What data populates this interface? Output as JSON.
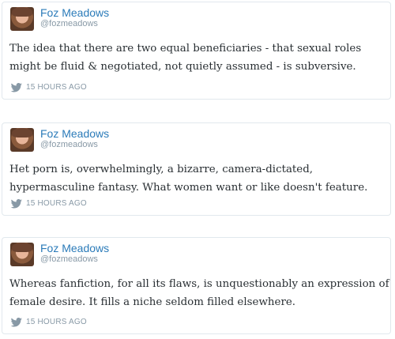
{
  "tweets": [
    {
      "author_name": "Foz Meadows",
      "author_handle": "@fozmeadows",
      "text": "The idea that there are two equal beneficiaries - that sexual roles might be fluid & negotiated, not quietly assumed - is subversive.",
      "timestamp": "15 HOURS AGO",
      "icon": "twitter-bird-icon"
    },
    {
      "author_name": "Foz Meadows",
      "author_handle": "@fozmeadows",
      "text": "Het porn is, overwhelmingly, a bizarre, camera-dictated, hypermasculine fantasy. What women want or like doesn't feature.",
      "timestamp": "15 HOURS AGO",
      "icon": "twitter-bird-icon"
    },
    {
      "author_name": "Foz Meadows",
      "author_handle": "@fozmeadows",
      "text": "Whereas fanfiction, for all its flaws, is unquestionably an expression of female desire. It fills a niche seldom filled elsewhere.",
      "timestamp": "15 HOURS AGO",
      "icon": "twitter-bird-icon"
    }
  ],
  "colors": {
    "name": "#2b7bb9",
    "meta": "#8899a6",
    "text": "#292f33",
    "border": "#e1e8ed"
  }
}
